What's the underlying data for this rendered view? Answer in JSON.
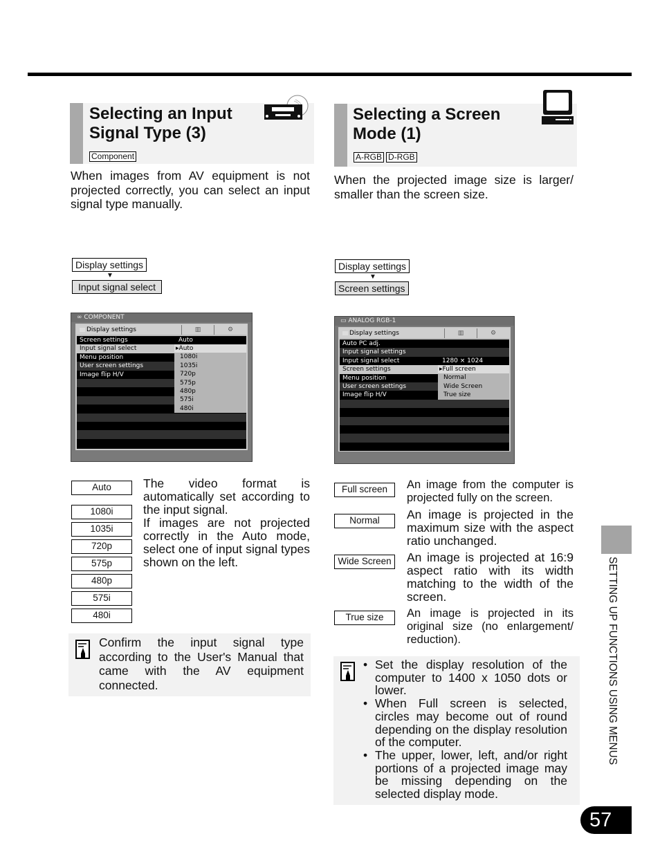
{
  "page": {
    "number": "57",
    "side_label": "SETTING UP FUNCTIONS USING MENUS"
  },
  "left": {
    "title": "Selecting an Input Signal Type (3)",
    "title_line1": "Selecting an Input",
    "title_line2": "Signal Type (3)",
    "icon": "av-equipment-disc-icon",
    "tags": [
      "Component"
    ],
    "intro": "When images from AV equipment is not projected correctly, you can select an input signal type manually.",
    "menu_path": [
      "Display settings",
      "Input signal select"
    ],
    "osd": {
      "source": "COMPONENT",
      "header": "Display settings",
      "rows": [
        {
          "label": "Screen settings",
          "value": "Auto"
        },
        {
          "label": "Input signal select",
          "value": ""
        },
        {
          "label": "Menu position",
          "value": ""
        },
        {
          "label": "User screen settings",
          "value": ""
        },
        {
          "label": "Image flip H/V",
          "value": ""
        }
      ],
      "dropdown": [
        "Auto",
        "1080i",
        "1035i",
        "720p",
        "575p",
        "480p",
        "575i",
        "480i"
      ],
      "selected": "Auto"
    },
    "options": [
      "Auto",
      "1080i",
      "1035i",
      "720p",
      "575p",
      "480p",
      "575i",
      "480i"
    ],
    "options_desc": "The video format is automatically set according to the input signal.",
    "options_desc2": "If images are not projected correctly in the Auto mode, select one of input signal types shown on the left.",
    "note": "Confirm the input signal type according to the User's Manual that came with the AV equipment connected."
  },
  "right": {
    "title_line1": "Selecting a Screen",
    "title_line2": "Mode (1)",
    "icon": "computer-monitor-icon",
    "tags": [
      "A-RGB",
      "D-RGB"
    ],
    "intro": "When the projected image size is larger/ smaller than the screen size.",
    "menu_path": [
      "Display settings",
      "Screen settings"
    ],
    "osd": {
      "source": "ANALOG RGB-1",
      "header": "Display settings",
      "rows": [
        {
          "label": "Auto PC adj.",
          "value": ""
        },
        {
          "label": "Input signal settings",
          "value": ""
        },
        {
          "label": "Input signal select",
          "value": "1280 × 1024"
        },
        {
          "label": "Screen settings",
          "value": ""
        },
        {
          "label": "Menu position",
          "value": ""
        },
        {
          "label": "User screen settings",
          "value": ""
        },
        {
          "label": "Image flip H/V",
          "value": ""
        }
      ],
      "dropdown": [
        "Full screen",
        "Normal",
        "Wide Screen",
        "True size"
      ],
      "selected": "Full screen"
    },
    "modes": [
      {
        "label": "Full screen",
        "desc": "An image from the computer is projected fully on the screen."
      },
      {
        "label": "Normal",
        "desc": "An image is projected in the maximum size with the aspect ratio unchanged."
      },
      {
        "label": "Wide Screen",
        "desc": "An image is projected at 16:9 aspect ratio with its width matching to the width of the screen."
      },
      {
        "label": "True size",
        "desc": "An image is projected in its original size (no enlargement/ reduction)."
      }
    ],
    "notes": [
      "Set the display resolution of the computer to 1400 x 1050 dots or lower.",
      "When Full screen is selected, circles may become out of round depending on the display resolution of the computer.",
      "The upper, lower, left, and/or right portions of a projected image may be missing depending on the selected display mode."
    ]
  }
}
